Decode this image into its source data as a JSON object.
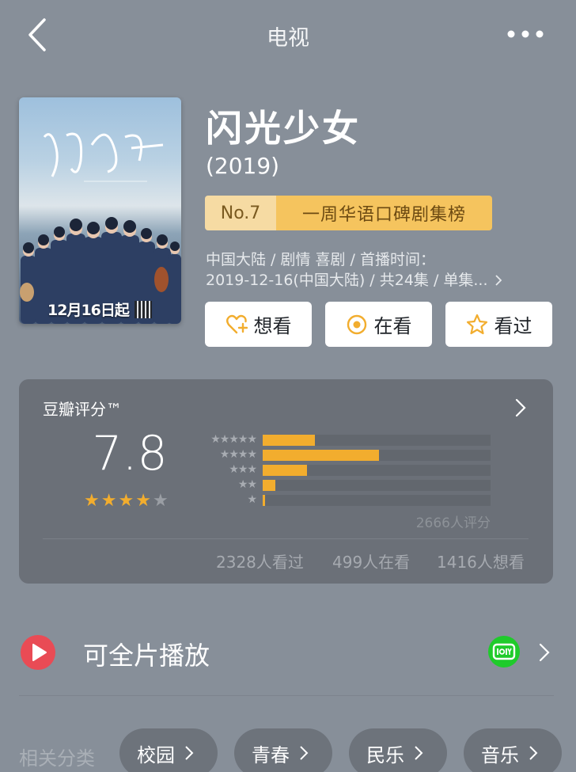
{
  "header": {
    "title": "电视",
    "back_icon": "back-chevron-icon",
    "more_icon": "more-dots-icon"
  },
  "poster": {
    "date_text": "12月16日起"
  },
  "show": {
    "title": "闪光少女",
    "year": "(2019)",
    "rank_no": "No.7",
    "rank_list": "一周华语口碑剧集榜",
    "meta_line1": "中国大陆 / 剧情 喜剧 / 首播时间：",
    "meta_line2": "2019-12-16(中国大陆) / 共24集 / 单集...",
    "actions": {
      "wish_label": "想看",
      "doing_label": "在看",
      "done_label": "看过"
    }
  },
  "rating": {
    "label": "豆瓣评分™",
    "score": "7.8",
    "stars": 4,
    "star_labels": [
      "★★★★★",
      "★★★★",
      "★★★",
      "★★",
      "★"
    ],
    "distribution": [
      0.23,
      0.51,
      0.195,
      0.055,
      0.01
    ],
    "count_text": "2666人评分",
    "watched_text": "2328人看过",
    "watching_text": "499人在看",
    "wish_text": "1416人想看",
    "bar_color": "#f2ad2e"
  },
  "play": {
    "label": "可全片播放",
    "provider_icon": "iqiyi-icon",
    "accent": "#e94b55"
  },
  "related": {
    "label": "相关分类",
    "tags": [
      "校园",
      "青春",
      "民乐",
      "音乐"
    ]
  }
}
